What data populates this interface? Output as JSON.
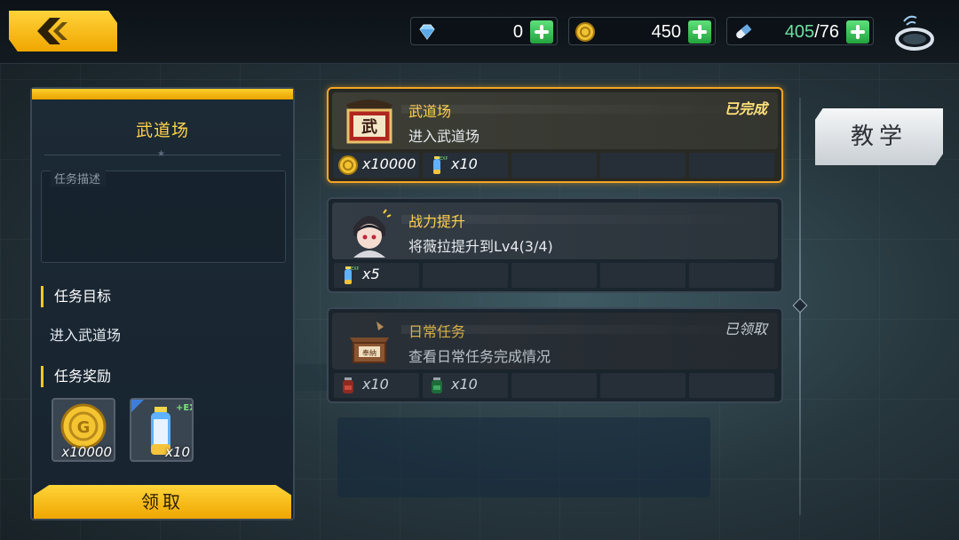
{
  "topbar": {
    "back_label": "",
    "resources": [
      {
        "icon": "diamond-icon",
        "value": "0"
      },
      {
        "icon": "gold-coin-icon",
        "value": "450"
      },
      {
        "icon": "stamina-capsule-icon",
        "current": "405",
        "max": "/76"
      }
    ],
    "stamina_color": "#6fe0a0"
  },
  "detail": {
    "title": "武道场",
    "description_label": "任务描述",
    "goal_heading": "任务目标",
    "goal_text": "进入武道场",
    "reward_heading": "任务奖励",
    "rewards": [
      {
        "icon": "gold-coin-icon",
        "qty": "x10000"
      },
      {
        "icon": "exp-drink-icon",
        "qty": "x10"
      }
    ],
    "claim_label": "领取"
  },
  "tasks": [
    {
      "name": "武道场",
      "description": "进入武道场",
      "status": "已完成",
      "rewards": [
        {
          "icon": "gold-coin-icon",
          "qty": "x10000"
        },
        {
          "icon": "exp-drink-icon",
          "qty": "x10"
        }
      ]
    },
    {
      "name": "战力提升",
      "description": "将薇拉提升到Lv4(3/4)",
      "status": "",
      "rewards": [
        {
          "icon": "exp-drink-icon",
          "qty": "x5"
        }
      ]
    },
    {
      "name": "日常任务",
      "description": "查看日常任务完成情况",
      "status": "已领取",
      "rewards": [
        {
          "icon": "red-potion-icon",
          "qty": "x10"
        },
        {
          "icon": "green-potion-icon",
          "qty": "x10"
        }
      ]
    }
  ],
  "tutorial_label": "教学",
  "colors": {
    "accent_gold": "#ffc628",
    "active_border": "#f5a623"
  }
}
